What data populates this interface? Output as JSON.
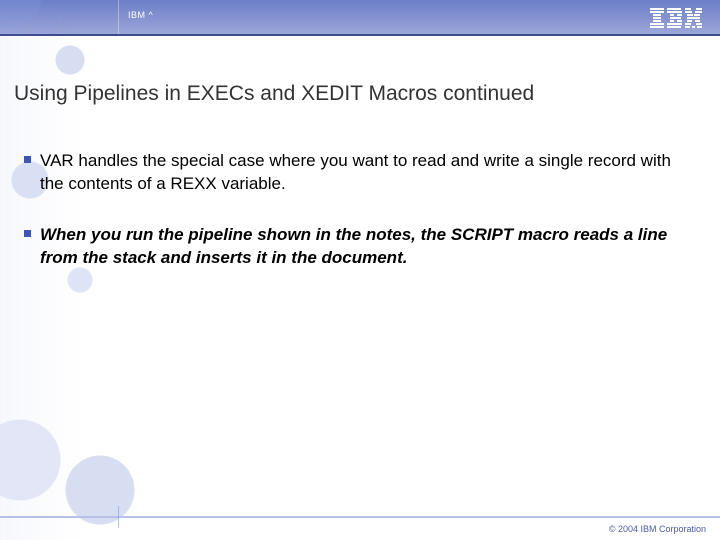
{
  "header": {
    "brand_small": "IBM ^",
    "logo_text": "IBM"
  },
  "title": "Using Pipelines in EXECs and XEDIT Macros continued",
  "bullets": [
    {
      "text": "VAR handles the special case where you want to read and write a single record with the contents of a REXX variable.",
      "emphasis": false
    },
    {
      "text": "When you run the pipeline shown in the notes, the SCRIPT macro reads a line from the stack and inserts it in the document.",
      "emphasis": true
    }
  ],
  "footer": {
    "copyright": "© 2004 IBM Corporation"
  },
  "colors": {
    "banner": "#6b7ec8",
    "bullet_square": "#3e55b5",
    "footer_text": "#4a5bb0"
  }
}
